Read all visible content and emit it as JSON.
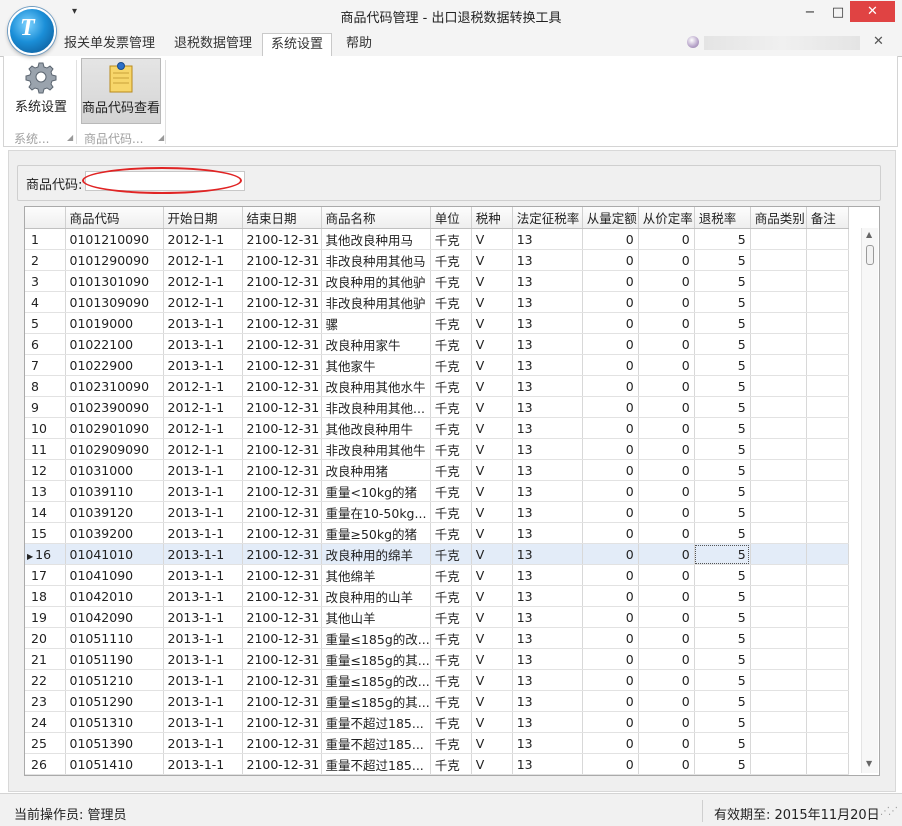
{
  "window": {
    "title": "商品代码管理 - 出口退税数据转换工具",
    "qat_glyph": "▾",
    "min_glyph": "−",
    "max_glyph": "□",
    "close_glyph": "✕",
    "logo_letter": "T"
  },
  "ribbon": {
    "tabs": [
      "报关单发票管理",
      "退税数据管理",
      "系统设置",
      "帮助"
    ],
    "active_tab": "系统设置",
    "close_glyph": "✕",
    "buttons": [
      {
        "label": "系统设置",
        "icon": "gear-icon"
      },
      {
        "label": "商品代码查看",
        "icon": "notepad-icon"
      }
    ],
    "groups": [
      "系统...",
      "商品代码..."
    ]
  },
  "search": {
    "label": "商品代码:",
    "value": ""
  },
  "grid": {
    "columns": [
      "",
      "商品代码",
      "开始日期",
      "结束日期",
      "商品名称",
      "单位",
      "税种",
      "法定征税率",
      "从量定额",
      "从价定率",
      "退税率",
      "商品类别",
      "备注"
    ],
    "selected_row": 16,
    "rows": [
      [
        "1",
        "0101210090",
        "2012-1-1",
        "2100-12-31",
        "其他改良种用马",
        "千克",
        "V",
        "13",
        "0",
        "0",
        "5",
        "",
        ""
      ],
      [
        "2",
        "0101290090",
        "2012-1-1",
        "2100-12-31",
        "非改良种用其他马",
        "千克",
        "V",
        "13",
        "0",
        "0",
        "5",
        "",
        ""
      ],
      [
        "3",
        "0101301090",
        "2012-1-1",
        "2100-12-31",
        "改良种用的其他驴",
        "千克",
        "V",
        "13",
        "0",
        "0",
        "5",
        "",
        ""
      ],
      [
        "4",
        "0101309090",
        "2012-1-1",
        "2100-12-31",
        "非改良种用其他驴",
        "千克",
        "V",
        "13",
        "0",
        "0",
        "5",
        "",
        ""
      ],
      [
        "5",
        "01019000",
        "2013-1-1",
        "2100-12-31",
        "骡",
        "千克",
        "V",
        "13",
        "0",
        "0",
        "5",
        "",
        ""
      ],
      [
        "6",
        "01022100",
        "2013-1-1",
        "2100-12-31",
        "改良种用家牛",
        "千克",
        "V",
        "13",
        "0",
        "0",
        "5",
        "",
        ""
      ],
      [
        "7",
        "01022900",
        "2013-1-1",
        "2100-12-31",
        "其他家牛",
        "千克",
        "V",
        "13",
        "0",
        "0",
        "5",
        "",
        ""
      ],
      [
        "8",
        "0102310090",
        "2012-1-1",
        "2100-12-31",
        "改良种用其他水牛",
        "千克",
        "V",
        "13",
        "0",
        "0",
        "5",
        "",
        ""
      ],
      [
        "9",
        "0102390090",
        "2012-1-1",
        "2100-12-31",
        "非改良种用其他...",
        "千克",
        "V",
        "13",
        "0",
        "0",
        "5",
        "",
        ""
      ],
      [
        "10",
        "0102901090",
        "2012-1-1",
        "2100-12-31",
        "其他改良种用牛",
        "千克",
        "V",
        "13",
        "0",
        "0",
        "5",
        "",
        ""
      ],
      [
        "11",
        "0102909090",
        "2012-1-1",
        "2100-12-31",
        "非改良种用其他牛",
        "千克",
        "V",
        "13",
        "0",
        "0",
        "5",
        "",
        ""
      ],
      [
        "12",
        "01031000",
        "2013-1-1",
        "2100-12-31",
        "改良种用猪",
        "千克",
        "V",
        "13",
        "0",
        "0",
        "5",
        "",
        ""
      ],
      [
        "13",
        "01039110",
        "2013-1-1",
        "2100-12-31",
        "重量<10kg的猪",
        "千克",
        "V",
        "13",
        "0",
        "0",
        "5",
        "",
        ""
      ],
      [
        "14",
        "01039120",
        "2013-1-1",
        "2100-12-31",
        "重量在10-50kg...",
        "千克",
        "V",
        "13",
        "0",
        "0",
        "5",
        "",
        ""
      ],
      [
        "15",
        "01039200",
        "2013-1-1",
        "2100-12-31",
        "重量≥50kg的猪",
        "千克",
        "V",
        "13",
        "0",
        "0",
        "5",
        "",
        ""
      ],
      [
        "16",
        "01041010",
        "2013-1-1",
        "2100-12-31",
        "改良种用的绵羊",
        "千克",
        "V",
        "13",
        "0",
        "0",
        "5",
        "",
        ""
      ],
      [
        "17",
        "01041090",
        "2013-1-1",
        "2100-12-31",
        "其他绵羊",
        "千克",
        "V",
        "13",
        "0",
        "0",
        "5",
        "",
        ""
      ],
      [
        "18",
        "01042010",
        "2013-1-1",
        "2100-12-31",
        "改良种用的山羊",
        "千克",
        "V",
        "13",
        "0",
        "0",
        "5",
        "",
        ""
      ],
      [
        "19",
        "01042090",
        "2013-1-1",
        "2100-12-31",
        "其他山羊",
        "千克",
        "V",
        "13",
        "0",
        "0",
        "5",
        "",
        ""
      ],
      [
        "20",
        "01051110",
        "2013-1-1",
        "2100-12-31",
        "重量≤185g的改...",
        "千克",
        "V",
        "13",
        "0",
        "0",
        "5",
        "",
        ""
      ],
      [
        "21",
        "01051190",
        "2013-1-1",
        "2100-12-31",
        "重量≤185g的其...",
        "千克",
        "V",
        "13",
        "0",
        "0",
        "5",
        "",
        ""
      ],
      [
        "22",
        "01051210",
        "2013-1-1",
        "2100-12-31",
        "重量≤185g的改...",
        "千克",
        "V",
        "13",
        "0",
        "0",
        "5",
        "",
        ""
      ],
      [
        "23",
        "01051290",
        "2013-1-1",
        "2100-12-31",
        "重量≤185g的其...",
        "千克",
        "V",
        "13",
        "0",
        "0",
        "5",
        "",
        ""
      ],
      [
        "24",
        "01051310",
        "2013-1-1",
        "2100-12-31",
        "重量不超过185...",
        "千克",
        "V",
        "13",
        "0",
        "0",
        "5",
        "",
        ""
      ],
      [
        "25",
        "01051390",
        "2013-1-1",
        "2100-12-31",
        "重量不超过185...",
        "千克",
        "V",
        "13",
        "0",
        "0",
        "5",
        "",
        ""
      ],
      [
        "26",
        "01051410",
        "2013-1-1",
        "2100-12-31",
        "重量不超过185...",
        "千克",
        "V",
        "13",
        "0",
        "0",
        "5",
        "",
        ""
      ]
    ]
  },
  "status": {
    "operator": "当前操作员: 管理员",
    "expiry": "有效期至: 2015年11月20日"
  }
}
